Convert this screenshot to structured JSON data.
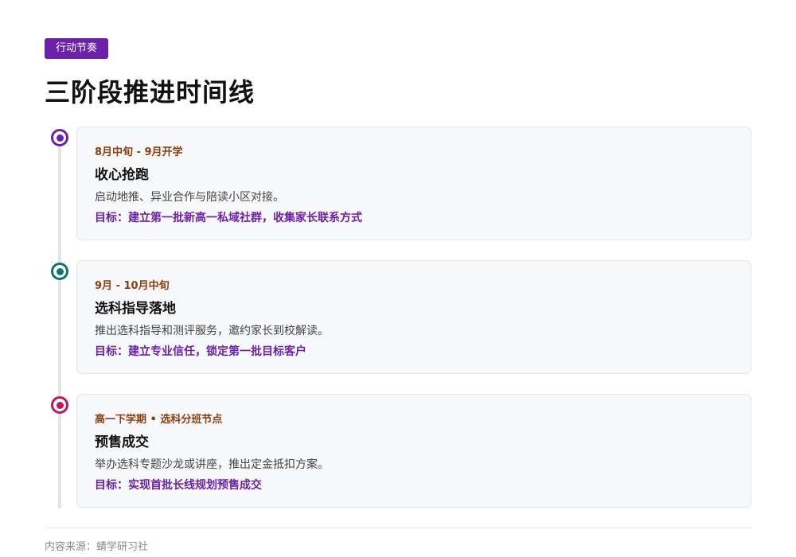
{
  "tag": "行动节奏",
  "title": "三阶段推进时间线",
  "stages": [
    {
      "period": "8月中旬 - 9月开学",
      "title": "收心抢跑",
      "desc": "启动地推、异业合作与陪读小区对接。",
      "goal": "目标：建立第一批新高一私域社群，收集家长联系方式",
      "color": "#6b21a8"
    },
    {
      "period": "9月 - 10月中旬",
      "title": "选科指导落地",
      "desc": "推出选科指导和测评服务，邀约家长到校解读。",
      "goal": "目标：建立专业信任，锁定第一批目标客户",
      "color": "#0f766e"
    },
    {
      "period": "高一下学期 • 选科分班节点",
      "title": "预售成交",
      "desc": "举办选科专题沙龙或讲座，推出定金抵扣方案。",
      "goal": "目标：实现首批长线规划预售成交",
      "color": "#be185d"
    }
  ],
  "footer": {
    "source": "内容来源：蜻学研习社"
  }
}
